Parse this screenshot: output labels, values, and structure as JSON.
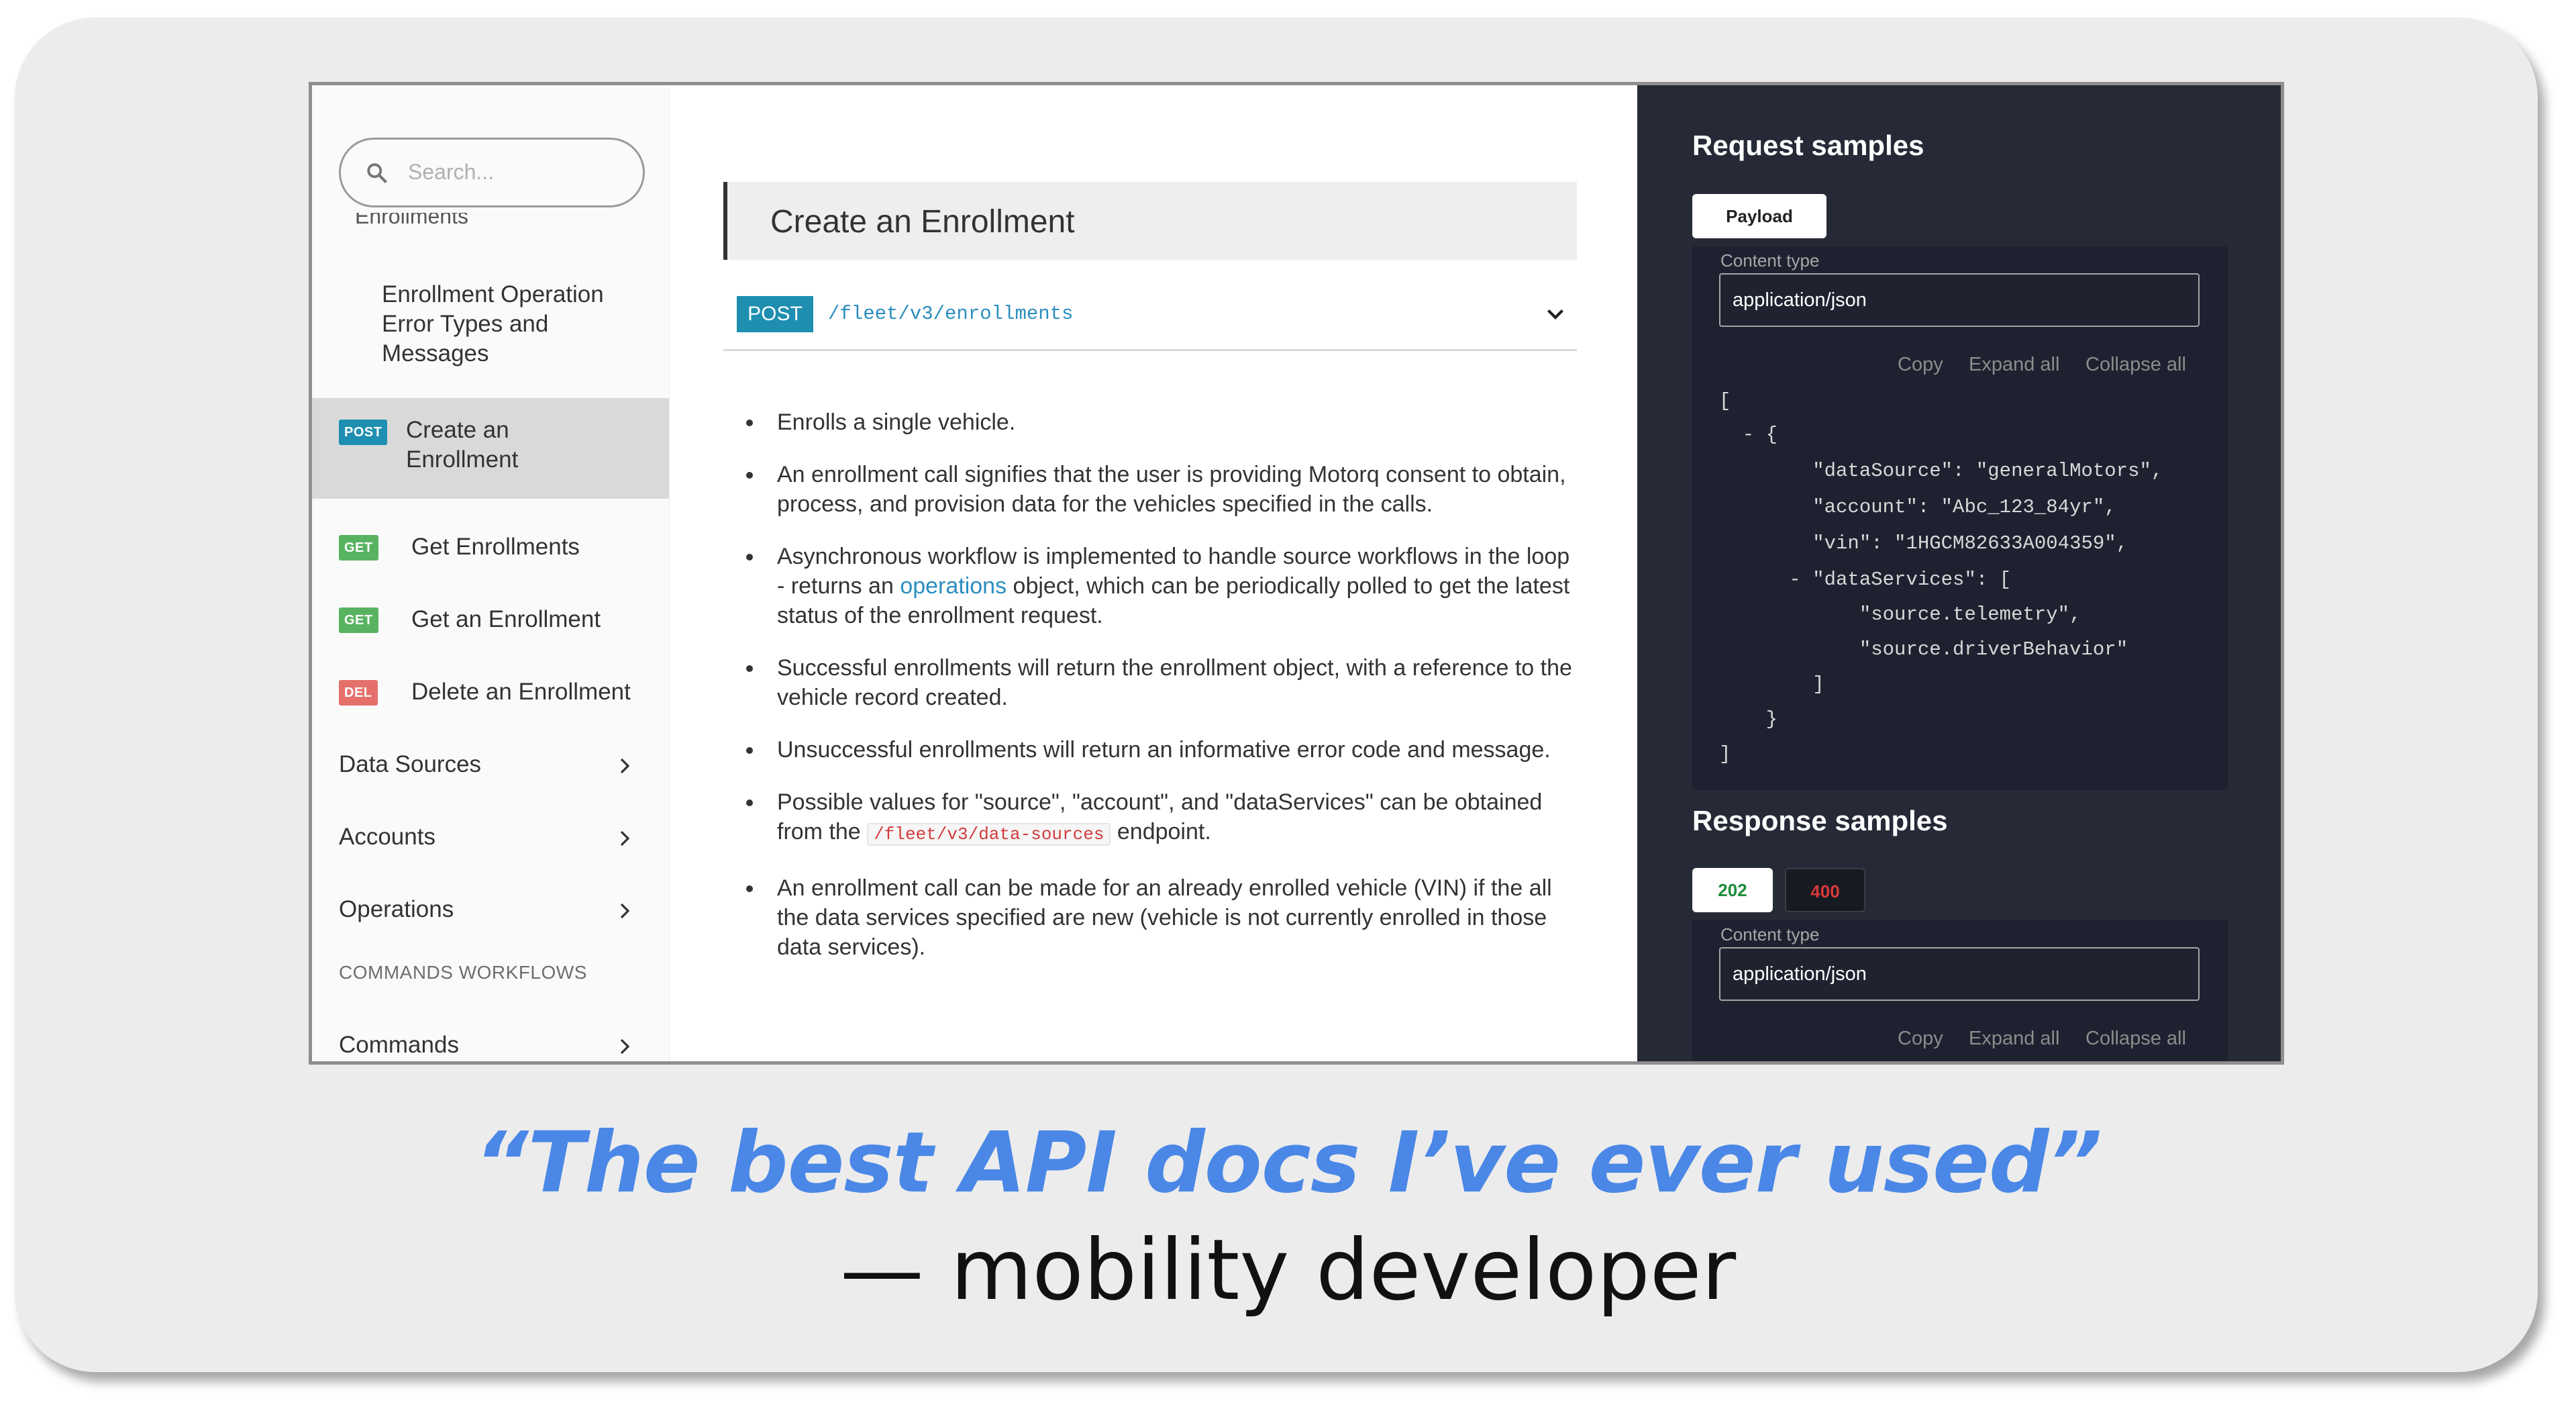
{
  "sidebar": {
    "search_placeholder": "Search...",
    "cut_item": "Enrollments",
    "items": [
      {
        "label_lines": [
          "Enrollment Operation",
          "Error Types and",
          "Messages"
        ]
      },
      {
        "method": "POST",
        "label_lines": [
          "Create an",
          "Enrollment"
        ]
      },
      {
        "method": "GET",
        "label": "Get Enrollments"
      },
      {
        "method": "GET",
        "label": "Get an Enrollment"
      },
      {
        "method": "DEL",
        "label": "Delete an Enrollment"
      },
      {
        "label": "Data Sources"
      },
      {
        "label": "Accounts"
      },
      {
        "label": "Operations"
      }
    ],
    "section_title": "COMMANDS WORKFLOWS",
    "section_items": [
      {
        "label": "Commands"
      }
    ]
  },
  "main": {
    "title": "Create an Enrollment",
    "method": "POST",
    "path": "/fleet/v3/enrollments",
    "bullets": [
      {
        "lines": [
          "Enrolls a single vehicle."
        ]
      },
      {
        "lines": [
          "An enrollment call signifies that the user is providing Motorq consent to obtain,",
          "process, and provision data for the vehicles specified in the calls."
        ]
      },
      {
        "line1": "Asynchronous workflow is implemented to handle source workflows in the loop",
        "line2_pre": "- returns an ",
        "line2_link": "operations",
        "line2_post": " object, which can be periodically polled to get the latest",
        "line3": "status of the enrollment request."
      },
      {
        "lines": [
          "Successful enrollments will return the enrollment object, with a reference to the",
          "vehicle record created."
        ]
      },
      {
        "lines": [
          "Unsuccessful enrollments will return an informative error code and message."
        ]
      },
      {
        "line1": "Possible values for \"source\", \"account\", and \"dataServices\" can be obtained",
        "line2_pre": "from the ",
        "line2_code": "/fleet/v3/data-sources",
        "line2_post": " endpoint."
      },
      {
        "lines": [
          "An enrollment call can be made for an already enrolled vehicle (VIN) if the all",
          "the data services specified are new (vehicle is not currently enrolled in those",
          "data services)."
        ]
      }
    ]
  },
  "request_samples": {
    "title": "Request samples",
    "tab": "Payload",
    "content_type_label": "Content type",
    "content_type": "application/json",
    "controls": [
      "Copy",
      "Expand all",
      "Collapse all"
    ],
    "code_lines": [
      "[",
      "  - {",
      "        \"dataSource\": \"generalMotors\",",
      "        \"account\": \"Abc_123_84yr\",",
      "        \"vin\": \"1HGCM82633A004359\",",
      "      - \"dataServices\": [",
      "            \"source.telemetry\",",
      "            \"source.driverBehavior\"",
      "        ]",
      "    }",
      "]"
    ]
  },
  "response_samples": {
    "title": "Response samples",
    "tabs": [
      {
        "label": "202",
        "color": "#1c8c3a"
      },
      {
        "label": "400",
        "color": "#d93a3a"
      }
    ],
    "content_type_label": "Content type",
    "content_type": "application/json",
    "controls": [
      "Copy",
      "Expand all",
      "Collapse all"
    ]
  },
  "colors": {
    "post": "#1e8fb0",
    "get": "#58b360",
    "del": "#e5706b",
    "quote": "#4a87e6"
  },
  "quote": {
    "text": "“The best API docs I’ve ever used”",
    "attribution": "— mobility developer"
  }
}
